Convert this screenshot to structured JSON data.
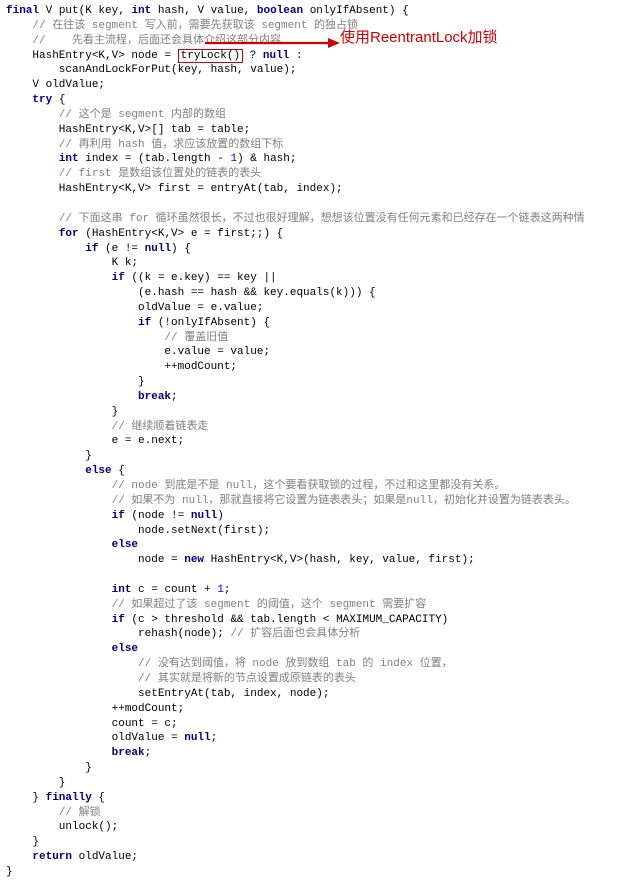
{
  "annotation": "使用ReentrantLock加锁",
  "code": {
    "l1a": "final",
    "l1b": " V put(K key, ",
    "l1c": "int",
    "l1d": " hash, V value, ",
    "l1e": "boolean",
    "l1f": " onlyIfAbsent) {",
    "l2": "    // 在往该 segment 写入前，需要先获取该 segment 的独占锁",
    "l3": "    //    先看主流程，后面还会具体介绍这部分内容",
    "l4a": "    HashEntry<K,V> node = ",
    "l4b": "tryLock()",
    "l4c": " ? ",
    "l4d": "null",
    "l4e": " :",
    "l5": "        scanAndLockForPut(key, hash, value);",
    "l6": "    V oldValue;",
    "l7a": "    ",
    "l7b": "try",
    "l7c": " {",
    "l8": "        // 这个是 segment 内部的数组",
    "l9": "        HashEntry<K,V>[] tab = table;",
    "l10": "        // 再利用 hash 值，求应该放置的数组下标",
    "l11a": "        ",
    "l11b": "int",
    "l11c": " index = (tab.length - ",
    "l11d": "1",
    "l11e": ") & hash;",
    "l12": "        // first 是数组该位置处的链表的表头",
    "l13": "        HashEntry<K,V> first = entryAt(tab, index);",
    "l14": "",
    "l15": "        // 下面这串 for 循环虽然很长，不过也很好理解，想想该位置没有任何元素和已经存在一个链表这两种情",
    "l16a": "        ",
    "l16b": "for",
    "l16c": " (HashEntry<K,V> e = first;;) {",
    "l17a": "            ",
    "l17b": "if",
    "l17c": " (e != ",
    "l17d": "null",
    "l17e": ") {",
    "l18": "                K k;",
    "l19a": "                ",
    "l19b": "if",
    "l19c": " ((k = e.key) == key ||",
    "l20": "                    (e.hash == hash && key.equals(k))) {",
    "l21": "                    oldValue = e.value;",
    "l22a": "                    ",
    "l22b": "if",
    "l22c": " (!onlyIfAbsent) {",
    "l23": "                        // 覆盖旧值",
    "l24": "                        e.value = value;",
    "l25": "                        ++modCount;",
    "l26": "                    }",
    "l27a": "                    ",
    "l27b": "break",
    "l27c": ";",
    "l28": "                }",
    "l29": "                // 继续顺着链表走",
    "l30": "                e = e.next;",
    "l31": "            }",
    "l32a": "            ",
    "l32b": "else",
    "l32c": " {",
    "l33": "                // node 到底是不是 null，这个要看获取锁的过程，不过和这里都没有关系。",
    "l34": "                // 如果不为 null，那就直接将它设置为链表表头；如果是null，初始化并设置为链表表头。",
    "l35a": "                ",
    "l35b": "if",
    "l35c": " (node != ",
    "l35d": "null",
    "l35e": ")",
    "l36": "                    node.setNext(first);",
    "l37a": "                ",
    "l37b": "else",
    "l38a": "                    node = ",
    "l38b": "new",
    "l38c": " HashEntry<K,V>(hash, key, value, first);",
    "l39": "",
    "l40a": "                ",
    "l40b": "int",
    "l40c": " c = count + ",
    "l40d": "1",
    "l40e": ";",
    "l41": "                // 如果超过了该 segment 的阈值，这个 segment 需要扩容",
    "l42a": "                ",
    "l42b": "if",
    "l42c": " (c > threshold && tab.length < MAXIMUM_CAPACITY)",
    "l43a": "                    rehash(node); ",
    "l43b": "// 扩容后面也会具体分析",
    "l44a": "                ",
    "l44b": "else",
    "l45": "                    // 没有达到阈值，将 node 放到数组 tab 的 index 位置，",
    "l46": "                    // 其实就是将新的节点设置成原链表的表头",
    "l47": "                    setEntryAt(tab, index, node);",
    "l48": "                ++modCount;",
    "l49": "                count = c;",
    "l50a": "                oldValue = ",
    "l50b": "null",
    "l50c": ";",
    "l51a": "                ",
    "l51b": "break",
    "l51c": ";",
    "l52": "            }",
    "l53": "        }",
    "l54a": "    } ",
    "l54b": "finally",
    "l54c": " {",
    "l55": "        // 解锁",
    "l56": "        unlock();",
    "l57": "    }",
    "l58a": "    ",
    "l58b": "return",
    "l58c": " oldValue;",
    "l59": "}"
  }
}
